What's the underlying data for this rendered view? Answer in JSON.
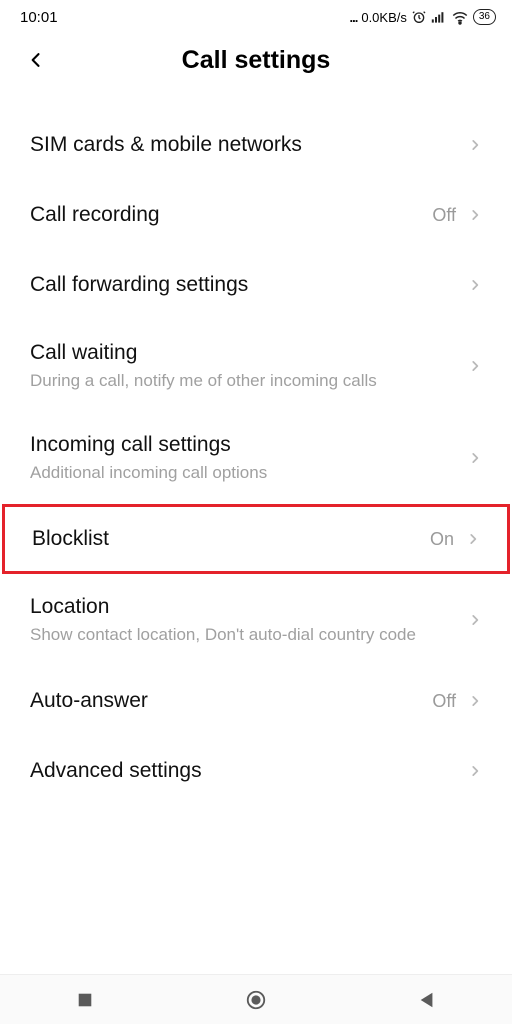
{
  "statusbar": {
    "time": "10:01",
    "dots": "...",
    "net_speed": "0.0KB/s",
    "battery": "36"
  },
  "header": {
    "title": "Call settings"
  },
  "rows": [
    {
      "title": "SIM cards & mobile networks",
      "sub": "",
      "value": "",
      "highlighted": false
    },
    {
      "title": "Call recording",
      "sub": "",
      "value": "Off",
      "highlighted": false
    },
    {
      "title": "Call forwarding settings",
      "sub": "",
      "value": "",
      "highlighted": false
    },
    {
      "title": "Call waiting",
      "sub": "During a call, notify me of other incoming calls",
      "value": "",
      "highlighted": false
    },
    {
      "title": "Incoming call settings",
      "sub": "Additional incoming call options",
      "value": "",
      "highlighted": false
    },
    {
      "title": "Blocklist",
      "sub": "",
      "value": "On",
      "highlighted": true
    },
    {
      "title": "Location",
      "sub": "Show contact location, Don't auto-dial country code",
      "value": "",
      "highlighted": false
    },
    {
      "title": "Auto-answer",
      "sub": "",
      "value": "Off",
      "highlighted": false
    },
    {
      "title": "Advanced settings",
      "sub": "",
      "value": "",
      "highlighted": false
    }
  ]
}
